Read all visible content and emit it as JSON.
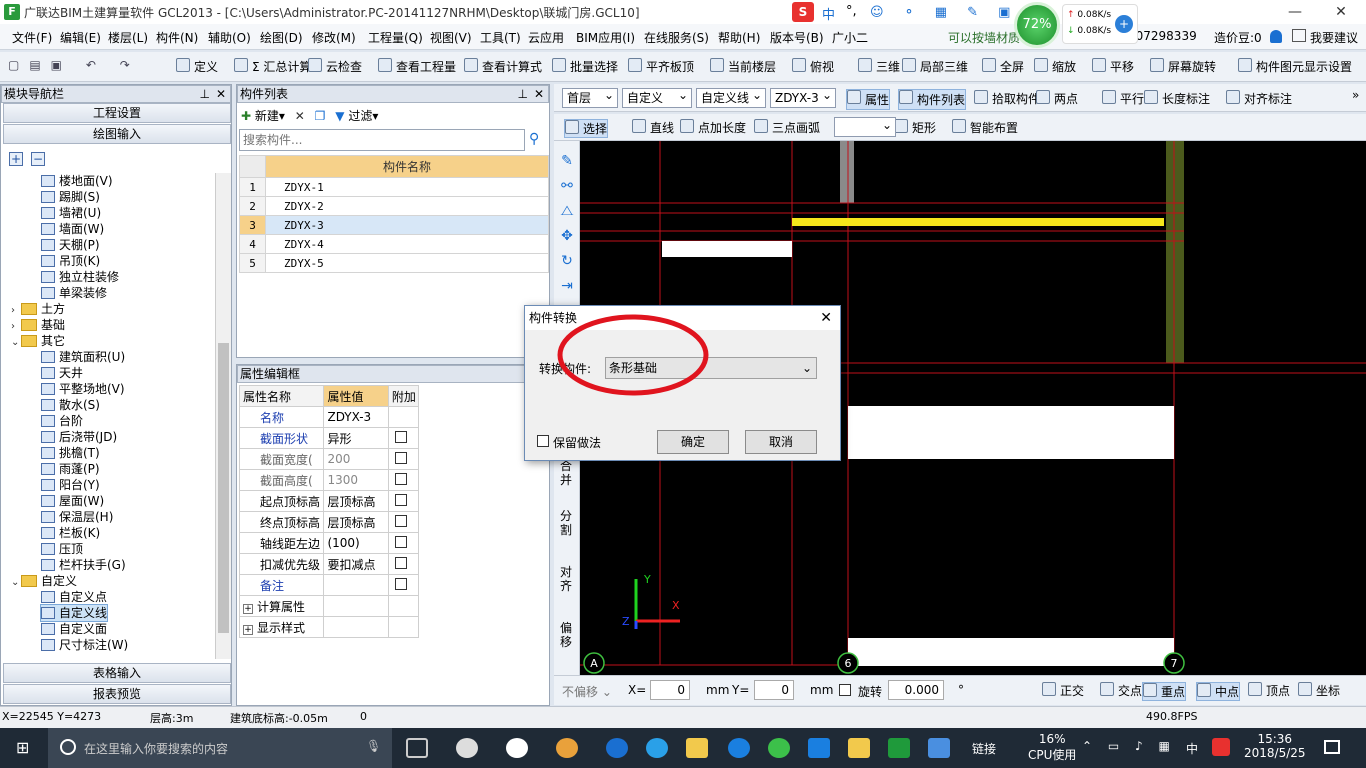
{
  "app": {
    "title": "广联达BIM土建算量软件 GCL2013 - [C:\\Users\\Administrator.PC-20141127NRHM\\Desktop\\联城门房.GCL10]",
    "logo_letter": "F"
  },
  "window_controls": {
    "minimize": "—",
    "restore": "❐",
    "close": "✕"
  },
  "ime": {
    "badge": "S",
    "lang": "中",
    "punct": "°,"
  },
  "network": {
    "percent": "72%",
    "up": "0.08K/s",
    "down": "0.08K/s"
  },
  "menu": [
    "文件(F)",
    "编辑(E)",
    "楼层(L)",
    "构件(N)",
    "辅助(O)",
    "绘图(D)",
    "修改(M)",
    "工程量(Q)",
    "视图(V)",
    "工具(T)",
    "云应用",
    "BIM应用(I)",
    "在线服务(S)",
    "帮助(H)",
    "版本号(B)",
    "广小二"
  ],
  "menu_right": {
    "tip": "可以按墙材质",
    "phone": "907298339",
    "beans": "造价豆:0",
    "suggest": "我要建议"
  },
  "toolbar1": [
    "定义",
    "Σ 汇总计算",
    "云检查",
    "查看工程量",
    "查看计算式",
    "批量选择",
    "平齐板顶",
    "当前楼层",
    "俯视",
    "三维",
    "局部三维",
    "全屏",
    "缩放",
    "平移",
    "屏幕旋转",
    "构件图元显示设置"
  ],
  "nav": {
    "title": "模块导航栏",
    "top_buttons": [
      "工程设置",
      "绘图输入"
    ],
    "bottom_buttons": [
      "表格输入",
      "报表预览"
    ],
    "tree": [
      {
        "label": "楼地面(V)",
        "level": 2,
        "kind": "item"
      },
      {
        "label": "踢脚(S)",
        "level": 2,
        "kind": "item"
      },
      {
        "label": "墙裙(U)",
        "level": 2,
        "kind": "item"
      },
      {
        "label": "墙面(W)",
        "level": 2,
        "kind": "item"
      },
      {
        "label": "天棚(P)",
        "level": 2,
        "kind": "item"
      },
      {
        "label": "吊顶(K)",
        "level": 2,
        "kind": "item"
      },
      {
        "label": "独立柱装修",
        "level": 2,
        "kind": "item"
      },
      {
        "label": "单梁装修",
        "level": 2,
        "kind": "item"
      },
      {
        "label": "土方",
        "level": 1,
        "kind": "folder",
        "exp": "›"
      },
      {
        "label": "基础",
        "level": 1,
        "kind": "folder",
        "exp": "›"
      },
      {
        "label": "其它",
        "level": 1,
        "kind": "folder",
        "exp": "⌄"
      },
      {
        "label": "建筑面积(U)",
        "level": 2,
        "kind": "item"
      },
      {
        "label": "天井",
        "level": 2,
        "kind": "item"
      },
      {
        "label": "平整场地(V)",
        "level": 2,
        "kind": "item"
      },
      {
        "label": "散水(S)",
        "level": 2,
        "kind": "item"
      },
      {
        "label": "台阶",
        "level": 2,
        "kind": "item"
      },
      {
        "label": "后浇带(JD)",
        "level": 2,
        "kind": "item"
      },
      {
        "label": "挑檐(T)",
        "level": 2,
        "kind": "item"
      },
      {
        "label": "雨蓬(P)",
        "level": 2,
        "kind": "item"
      },
      {
        "label": "阳台(Y)",
        "level": 2,
        "kind": "item"
      },
      {
        "label": "屋面(W)",
        "level": 2,
        "kind": "item"
      },
      {
        "label": "保温层(H)",
        "level": 2,
        "kind": "item"
      },
      {
        "label": "栏板(K)",
        "level": 2,
        "kind": "item"
      },
      {
        "label": "压顶",
        "level": 2,
        "kind": "item"
      },
      {
        "label": "栏杆扶手(G)",
        "level": 2,
        "kind": "item"
      },
      {
        "label": "自定义",
        "level": 1,
        "kind": "folder",
        "exp": "⌄"
      },
      {
        "label": "自定义点",
        "level": 2,
        "kind": "item"
      },
      {
        "label": "自定义线",
        "level": 2,
        "kind": "item",
        "selected": true
      },
      {
        "label": "自定义面",
        "level": 2,
        "kind": "item"
      },
      {
        "label": "尺寸标注(W)",
        "level": 2,
        "kind": "item"
      }
    ]
  },
  "components": {
    "title": "构件列表",
    "new_label": "新建",
    "filter_label": "过滤",
    "search_placeholder": "搜索构件...",
    "col_header": "构件名称",
    "rows": [
      {
        "idx": "1",
        "name": "ZDYX-1"
      },
      {
        "idx": "2",
        "name": "ZDYX-2"
      },
      {
        "idx": "3",
        "name": "ZDYX-3",
        "selected": true
      },
      {
        "idx": "4",
        "name": "ZDYX-4"
      },
      {
        "idx": "5",
        "name": "ZDYX-5"
      }
    ]
  },
  "properties": {
    "title": "属性编辑框",
    "headers": [
      "属性名称",
      "属性值",
      "附加"
    ],
    "rows": [
      {
        "name": "名称",
        "value": "ZDYX-3",
        "blue": true,
        "check": false
      },
      {
        "name": "截面形状",
        "value": "异形",
        "blue": true,
        "check": true
      },
      {
        "name": "截面宽度(",
        "value": "200",
        "gray": true,
        "check": true
      },
      {
        "name": "截面高度(",
        "value": "1300",
        "gray": true,
        "check": true
      },
      {
        "name": "起点顶标高",
        "value": "层顶标高",
        "check": true
      },
      {
        "name": "终点顶标高",
        "value": "层顶标高",
        "check": true
      },
      {
        "name": "轴线距左边",
        "value": "(100)",
        "check": true
      },
      {
        "name": "扣减优先级",
        "value": "要扣减点",
        "check": true
      },
      {
        "name": "备注",
        "value": "",
        "blue": true,
        "check": true
      },
      {
        "name": "计算属性",
        "value": "",
        "expand": true
      },
      {
        "name": "显示样式",
        "value": "",
        "expand": true
      }
    ]
  },
  "viewbar": {
    "floor": "首层",
    "type": "自定义",
    "subtype": "自定义线",
    "comp": "ZDYX-3",
    "buttons": [
      "属性",
      "构件列表",
      "拾取构件",
      "两点",
      "平行",
      "长度标注",
      "对齐标注"
    ]
  },
  "viewbar2": {
    "buttons": [
      "选择",
      "直线",
      "点加长度",
      "三点画弧",
      "矩形",
      "智能布置"
    ]
  },
  "sidetools": [
    "合并",
    "分割",
    "对齐",
    "偏移"
  ],
  "canvas": {
    "axis_labels": [
      "A",
      "6",
      "7"
    ],
    "ucs": {
      "x": "X",
      "y": "Y",
      "z": "Z"
    }
  },
  "snapbar": {
    "offset": "不偏移",
    "x_label": "X=",
    "x_val": "0",
    "y_label": "Y=",
    "y_val": "0",
    "unit": "mm",
    "rotate_label": "旋转",
    "rotate_val": "0.000",
    "deg": "°",
    "snaps": [
      "正交",
      "交点",
      "重点",
      "中点",
      "顶点",
      "坐标"
    ]
  },
  "statusbar": {
    "coords": "X=22545 Y=4273",
    "floor_height": "层高:3m",
    "base_height": "建筑底标高:-0.05m",
    "zero": "0",
    "fps": "490.8FPS"
  },
  "dialog": {
    "title": "构件转换",
    "label": "转换构件:",
    "value": "条形基础",
    "keep_label": "保留做法",
    "ok": "确定",
    "cancel": "取消"
  },
  "taskbar": {
    "search": "在这里输入你要搜索的内容",
    "link": "链接",
    "cpu_pct": "16%",
    "cpu_label": "CPU使用",
    "ime": "中",
    "time": "15:36",
    "date": "2018/5/25"
  },
  "colors": {
    "annotation_red": "#e0141e",
    "accent_blue": "#1a6fd1"
  }
}
